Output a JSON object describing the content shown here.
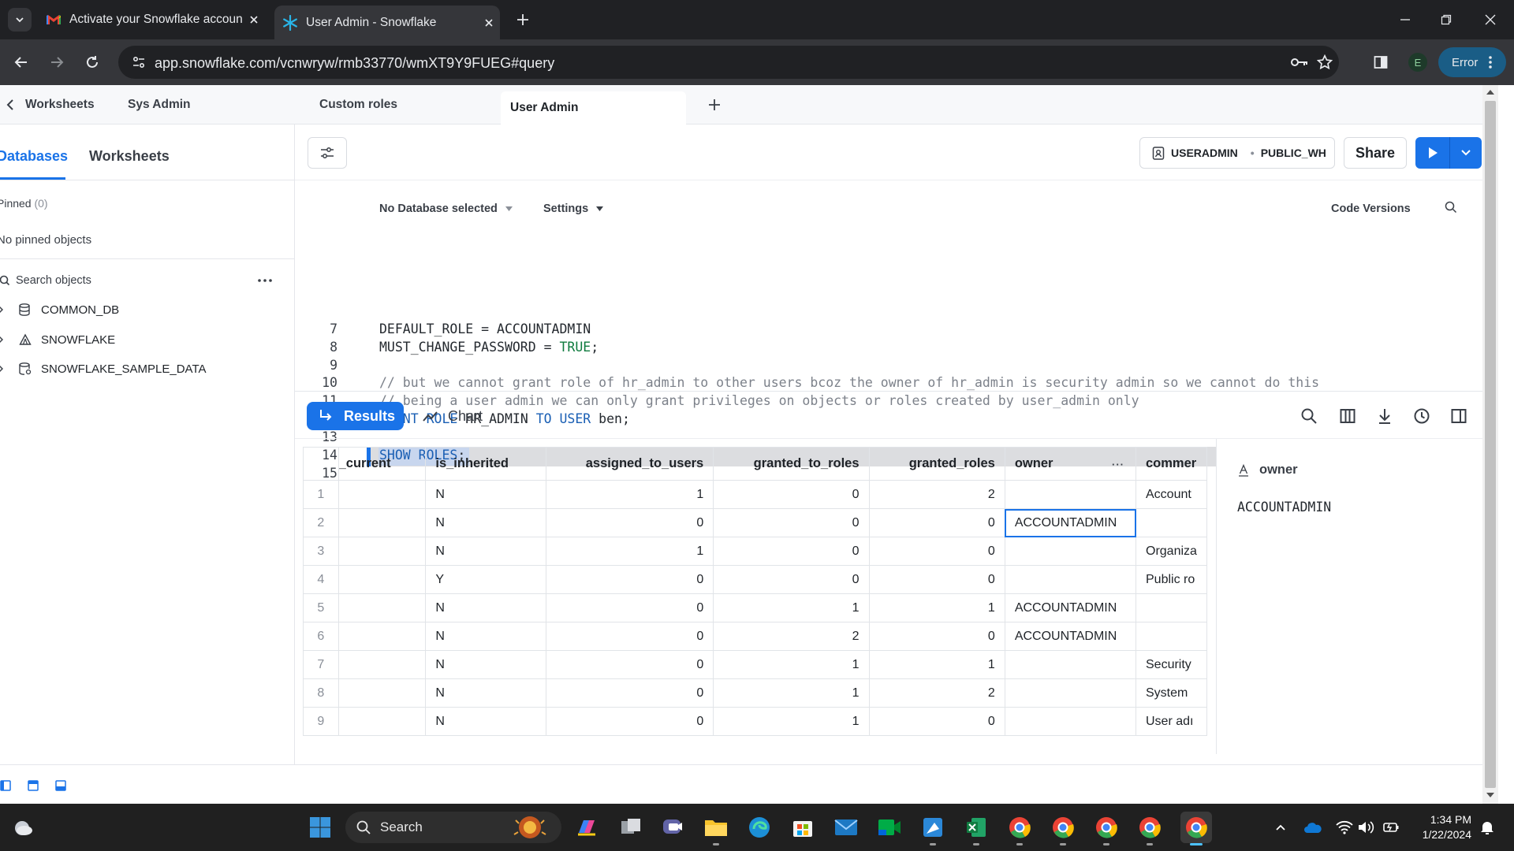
{
  "browser": {
    "tabs": [
      {
        "title": "Activate your Snowflake accoun",
        "icon": "gmail-icon"
      },
      {
        "title": "User Admin - Snowflake",
        "icon": "snowflake-icon"
      }
    ],
    "url": "app.snowflake.com/vcnwryw/rmb33770/wmXT9Y9FUEG#query",
    "profile_initial": "E",
    "error_label": "Error"
  },
  "worksheet_tabs": {
    "back_label": "Worksheets",
    "items": [
      "Sys Admin",
      "Custom roles",
      "User Admin"
    ],
    "active": "User Admin"
  },
  "sidebar": {
    "tab_databases": "Databases",
    "tab_worksheets": "Worksheets",
    "pinned_label": "Pinned",
    "pinned_count": "(0)",
    "no_pinned": "No pinned objects",
    "search_placeholder": "Search objects",
    "databases": [
      "COMMON_DB",
      "SNOWFLAKE",
      "SNOWFLAKE_SAMPLE_DATA"
    ]
  },
  "editor": {
    "role": "USERADMIN",
    "warehouse": "PUBLIC_WH",
    "share_label": "Share",
    "db_selector": "No Database selected",
    "settings_label": "Settings",
    "code_versions_label": "Code Versions",
    "lines": [
      {
        "n": "7",
        "parts": [
          {
            "t": "DEFAULT_ROLE = ACCOUNTADMIN",
            "c": ""
          }
        ]
      },
      {
        "n": "8",
        "parts": [
          {
            "t": "MUST_CHANGE_PASSWORD = ",
            "c": ""
          },
          {
            "t": "TRUE",
            "c": "tr"
          },
          {
            "t": ";",
            "c": ""
          }
        ]
      },
      {
        "n": "9",
        "parts": []
      },
      {
        "n": "10",
        "parts": [
          {
            "t": "// but we cannot grant role of hr_admin to other users bcoz the owner of hr_admin is security admin so we cannot do this",
            "c": "cm"
          }
        ]
      },
      {
        "n": "11",
        "parts": [
          {
            "t": "// being a user admin we can only grant privileges on objects or roles created by user_admin only",
            "c": "cm"
          }
        ]
      },
      {
        "n": "12",
        "parts": [
          {
            "t": "GRANT ROLE",
            "c": "kw"
          },
          {
            "t": " HR_ADMIN ",
            "c": ""
          },
          {
            "t": "TO USER",
            "c": "kw"
          },
          {
            "t": " ben;",
            "c": ""
          }
        ]
      },
      {
        "n": "13",
        "parts": []
      },
      {
        "n": "14",
        "parts": [
          {
            "t": "SHOW ROLES",
            "c": "kw"
          },
          {
            "t": ";",
            "c": ""
          }
        ]
      },
      {
        "n": "15",
        "parts": []
      }
    ]
  },
  "results": {
    "results_label": "Results",
    "chart_label": "Chart",
    "columns": [
      "_current",
      "is_inherited",
      "assigned_to_users",
      "granted_to_roles",
      "granted_roles",
      "owner",
      "commer"
    ],
    "rows": [
      [
        "1",
        "",
        "N",
        "1",
        "0",
        "2",
        "",
        "Account"
      ],
      [
        "2",
        "",
        "N",
        "0",
        "0",
        "0",
        "ACCOUNTADMIN",
        ""
      ],
      [
        "3",
        "",
        "N",
        "1",
        "0",
        "0",
        "",
        "Organiza"
      ],
      [
        "4",
        "",
        "Y",
        "0",
        "0",
        "0",
        "",
        "Public ro"
      ],
      [
        "5",
        "",
        "N",
        "0",
        "1",
        "1",
        "ACCOUNTADMIN",
        ""
      ],
      [
        "6",
        "",
        "N",
        "0",
        "2",
        "0",
        "ACCOUNTADMIN",
        ""
      ],
      [
        "7",
        "",
        "N",
        "0",
        "1",
        "1",
        "",
        "Security"
      ],
      [
        "8",
        "",
        "N",
        "0",
        "1",
        "2",
        "",
        "System"
      ],
      [
        "9",
        "",
        "N",
        "0",
        "1",
        "0",
        "",
        "User adı"
      ]
    ],
    "detail_header": "owner",
    "detail_value": "ACCOUNTADMIN"
  },
  "taskbar": {
    "search_label": "Search",
    "time": "1:34 PM",
    "date": "1/22/2024"
  },
  "colors": {
    "accent": "#1a73e8",
    "chrome_dark": "#202124",
    "taskbar": "#202020"
  }
}
